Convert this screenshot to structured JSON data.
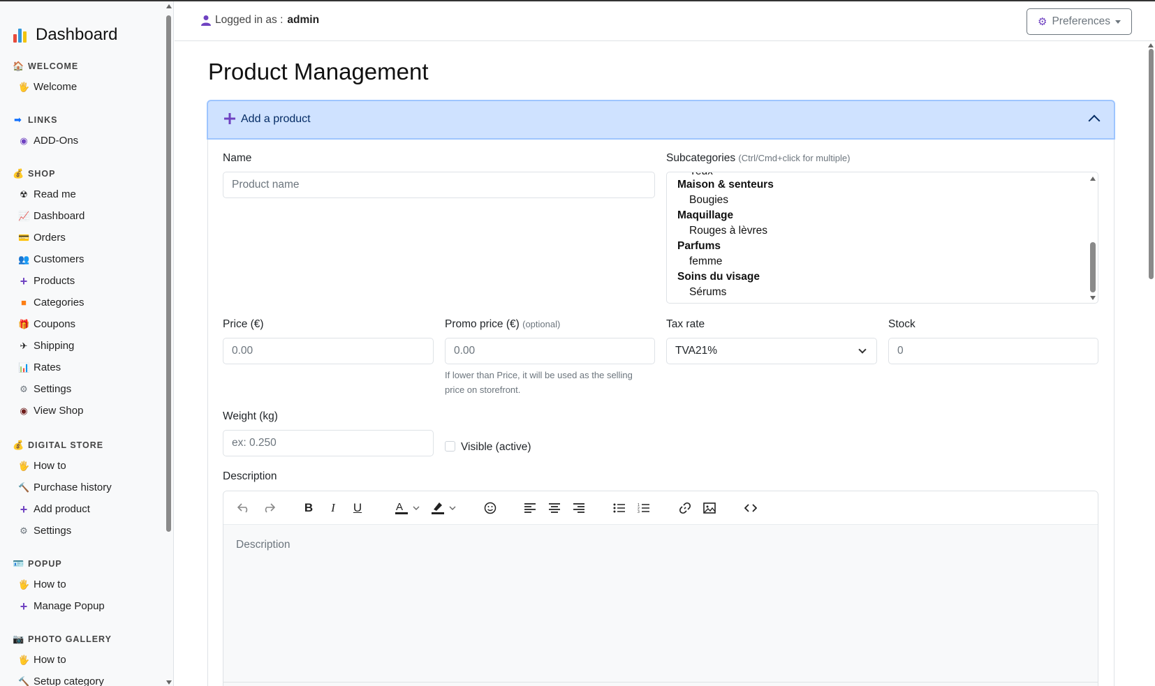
{
  "sidebar": {
    "brand": "Dashboard",
    "sections": [
      {
        "label": "WELCOME",
        "icon": "house-icon"
      },
      {
        "label": "LINKS",
        "icon": "arrow-right-icon"
      },
      {
        "label": "SHOP",
        "icon": "money-bag-icon"
      },
      {
        "label": "DIGITAL STORE",
        "icon": "money-bag-icon"
      },
      {
        "label": "POPUP",
        "icon": "id-card-icon"
      },
      {
        "label": "PHOTO GALLERY",
        "icon": "camera-icon"
      }
    ],
    "items": {
      "welcome": "Welcome",
      "addons": "ADD-Ons",
      "readme": "Read me",
      "dashboard": "Dashboard",
      "orders": "Orders",
      "customers": "Customers",
      "products": "Products",
      "categories": "Categories",
      "coupons": "Coupons",
      "shipping": "Shipping",
      "rates": "Rates",
      "settings": "Settings",
      "viewshop": "View Shop",
      "ds_howto": "How to",
      "ds_purchase": "Purchase history",
      "ds_addproduct": "Add product",
      "ds_settings": "Settings",
      "popup_howto": "How to",
      "popup_manage": "Manage Popup",
      "gallery_howto": "How to",
      "gallery_setup": "Setup category"
    }
  },
  "header": {
    "logged_prefix": "Logged in as :",
    "user": "admin",
    "preferences": "Preferences"
  },
  "main": {
    "title": "Product Management",
    "accordion_label": "Add a product",
    "form": {
      "name_label": "Name",
      "name_placeholder": "Product name",
      "subcat_label": "Subcategories",
      "subcat_hint": "(Ctrl/Cmd+click for multiple)",
      "subcat_partial": "Yeux",
      "subcat_options": [
        {
          "text": "Maison & senteurs",
          "group": true
        },
        {
          "text": "Bougies",
          "group": false
        },
        {
          "text": "Maquillage",
          "group": true
        },
        {
          "text": "Rouges à lèvres",
          "group": false
        },
        {
          "text": "Parfums",
          "group": true
        },
        {
          "text": "femme",
          "group": false
        },
        {
          "text": "Soins du visage",
          "group": true
        },
        {
          "text": "Sérums",
          "group": false
        }
      ],
      "price_label": "Price (€)",
      "price_placeholder": "0.00",
      "promo_label": "Promo price (€)",
      "promo_optional": "(optional)",
      "promo_placeholder": "0.00",
      "promo_help": "If lower than Price, it will be used as the selling price on storefront.",
      "tax_label": "Tax rate",
      "tax_value": "TVA21%",
      "stock_label": "Stock",
      "stock_placeholder": "0",
      "weight_label": "Weight (kg)",
      "weight_placeholder": "ex: 0.250",
      "visible_label": "Visible (active)",
      "visible_checked": false,
      "description_label": "Description",
      "description_placeholder": "Description"
    }
  },
  "colors": {
    "accordion_bg": "#cfe2ff",
    "accordion_border": "#9ec5fe",
    "accordion_text": "#052c65",
    "accent_purple": "#6f42c1"
  }
}
